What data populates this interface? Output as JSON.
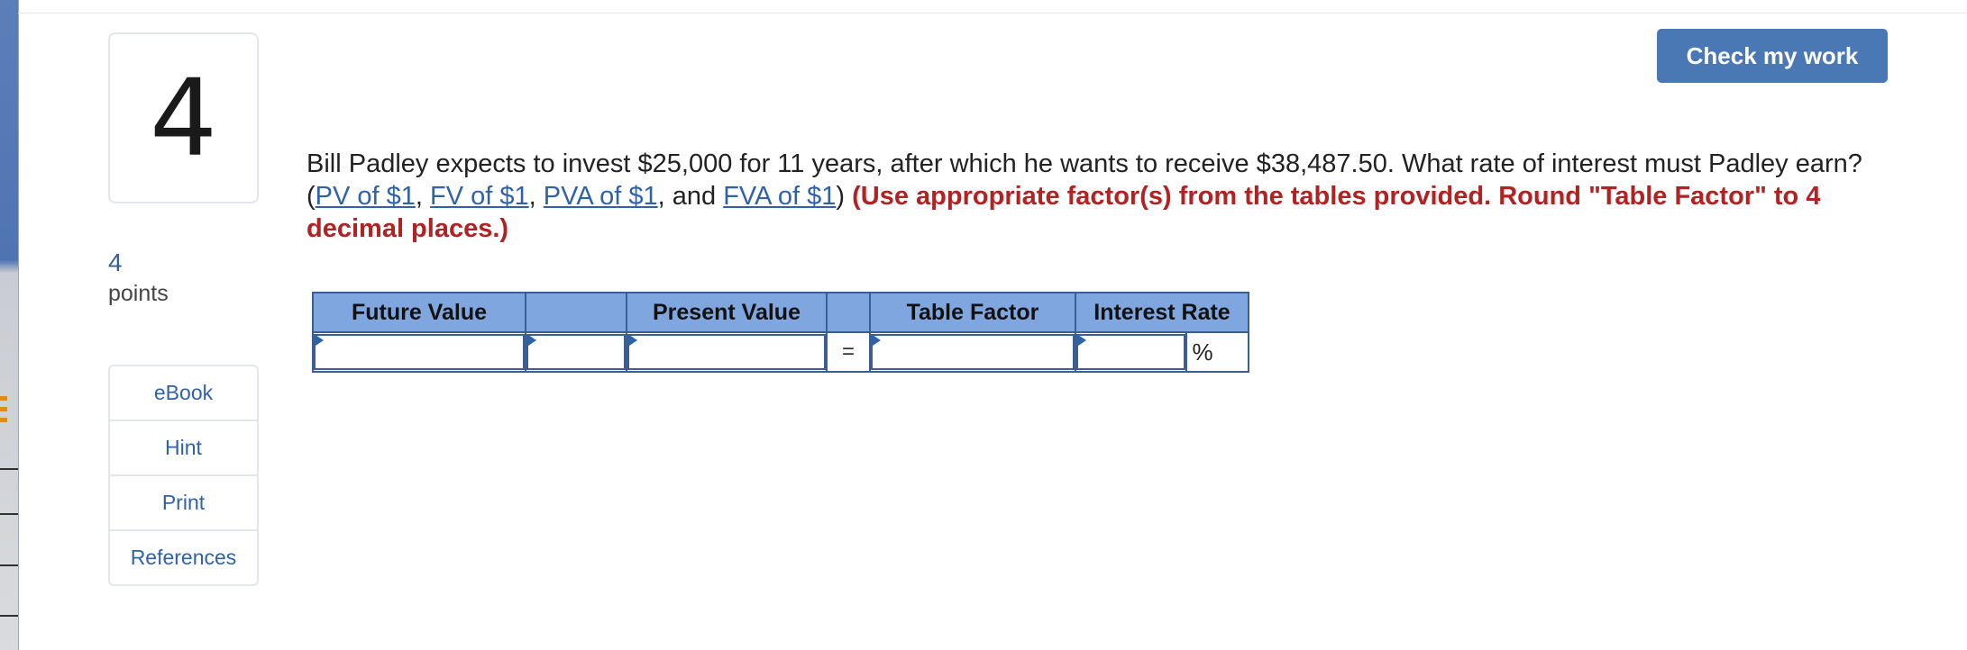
{
  "question": {
    "number": "4",
    "points_value": "4",
    "points_label": "points",
    "text_part1": "Bill Padley expects to invest $25,000 for 11 years, after which he wants to receive $38,487.50. What rate of interest must Padley earn? (",
    "link_pv": "PV of $1",
    "sep1": ", ",
    "link_fv": "FV of $1",
    "sep2": ", ",
    "link_pva": "PVA of $1",
    "sep3": ", and ",
    "link_fva": "FVA of $1",
    "text_close": ") ",
    "instruction": "(Use appropriate factor(s) from the tables provided. Round \"Table Factor\" to 4 decimal places.)"
  },
  "actions": {
    "check_label": "Check my work"
  },
  "side_links": {
    "ebook": "eBook",
    "hint": "Hint",
    "print": "Print",
    "references": "References"
  },
  "table": {
    "headers": {
      "future_value": "Future Value",
      "blank1": "",
      "present_value": "Present Value",
      "blank2": "",
      "table_factor": "Table Factor",
      "interest_rate": "Interest Rate"
    },
    "row": {
      "future_value": "",
      "operator": "",
      "present_value": "",
      "equals": "=",
      "table_factor": "",
      "interest_rate": "",
      "percent_sign": "%"
    }
  },
  "colors": {
    "link": "#2f62a8",
    "instruction": "#b22222",
    "button": "#4a78b5",
    "table_header": "#7fa6de"
  }
}
